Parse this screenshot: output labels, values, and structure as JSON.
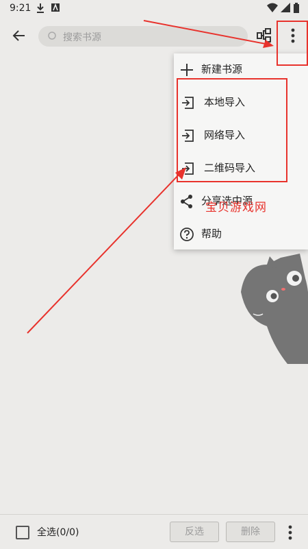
{
  "status_bar": {
    "time": "9:21"
  },
  "search": {
    "placeholder": "搜索书源"
  },
  "menu": {
    "items": [
      {
        "label": "新建书源",
        "icon": "plus-icon"
      },
      {
        "label": "本地导入",
        "icon": "import-icon"
      },
      {
        "label": "网络导入",
        "icon": "import-icon"
      },
      {
        "label": "二维码导入",
        "icon": "import-icon"
      },
      {
        "label": "分享选中源",
        "icon": "share-icon"
      },
      {
        "label": "帮助",
        "icon": "help-icon"
      }
    ]
  },
  "watermark": "宝贝游戏网",
  "bottom_bar": {
    "select_all": "全选(0/0)",
    "invert_label": "反选",
    "delete_label": "删除"
  },
  "colors": {
    "annotation_red": "#e8322c",
    "background": "#ecebe9"
  }
}
